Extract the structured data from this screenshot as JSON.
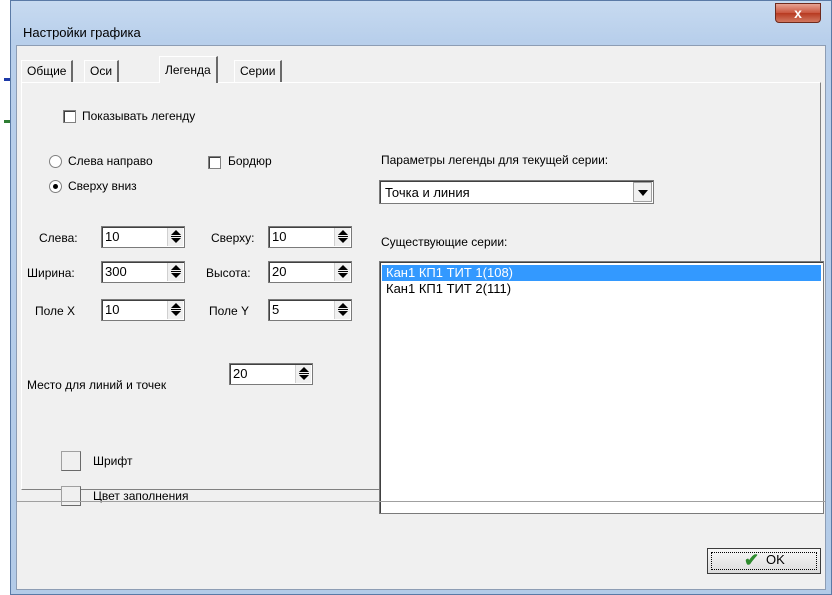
{
  "window": {
    "title": "Настройки графика",
    "close_glyph": "x"
  },
  "tabs": [
    {
      "label": "Общие"
    },
    {
      "label": "Оси"
    },
    {
      "label": "Легенда"
    },
    {
      "label": "Серии"
    }
  ],
  "legend": {
    "show_label": "Показывать легенду",
    "show_checked": false,
    "direction": {
      "left_to_right_label": "Слева направо",
      "top_to_bottom_label": "Сверху вниз",
      "selected": "top_to_bottom"
    },
    "border_label": "Бордюр",
    "border_checked": false,
    "fields": {
      "left_label": "Слева:",
      "left_value": "10",
      "top_label": "Сверху:",
      "top_value": "10",
      "width_label": "Ширина:",
      "width_value": "300",
      "height_label": "Высота:",
      "height_value": "20",
      "fieldx_label": "Поле X",
      "fieldx_value": "10",
      "fieldy_label": "Поле Y",
      "fieldy_value": "5",
      "space_label": "Место для линий и точек",
      "space_value": "20"
    },
    "font_label": "Шрифт",
    "fill_color_label": "Цвет заполнения"
  },
  "series_params": {
    "label": "Параметры легенды для текущей серии:",
    "style_value": "Точка и линия",
    "existing_label": "Существующие серии:",
    "series": [
      {
        "name": "Кан1 КП1 ТИТ 1(108)",
        "selected": true
      },
      {
        "name": "Кан1 КП1 ТИТ 2(111)",
        "selected": false
      }
    ]
  },
  "footer": {
    "ok_label": "OK"
  },
  "colors": {
    "selection": "#3399ff",
    "close_button": "#c9553e",
    "frame": "#b8cfeb"
  }
}
